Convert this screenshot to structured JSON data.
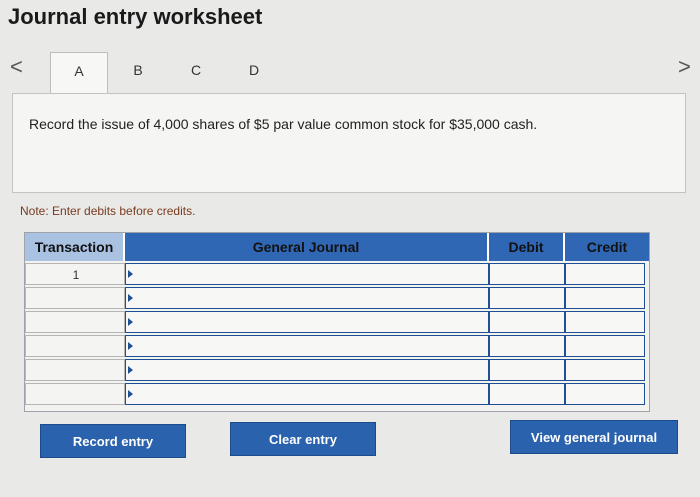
{
  "header": {
    "title": "Journal entry worksheet"
  },
  "nav": {
    "prev_icon": "chevron-left-icon",
    "next_icon": "chevron-right-icon",
    "prev_glyph": "<",
    "next_glyph": ">"
  },
  "tabs": [
    {
      "label": "A",
      "active": true
    },
    {
      "label": "B",
      "active": false
    },
    {
      "label": "C",
      "active": false
    },
    {
      "label": "D",
      "active": false
    }
  ],
  "instruction": "Record the issue of 4,000 shares of $5 par value common stock for $35,000 cash.",
  "note": "Note: Enter debits before credits.",
  "journal": {
    "columns": [
      "Transaction",
      "General Journal",
      "Debit",
      "Credit"
    ],
    "rows": [
      {
        "transaction": "1",
        "account": "",
        "debit": "",
        "credit": ""
      },
      {
        "transaction": "",
        "account": "",
        "debit": "",
        "credit": ""
      },
      {
        "transaction": "",
        "account": "",
        "debit": "",
        "credit": ""
      },
      {
        "transaction": "",
        "account": "",
        "debit": "",
        "credit": ""
      },
      {
        "transaction": "",
        "account": "",
        "debit": "",
        "credit": ""
      },
      {
        "transaction": "",
        "account": "",
        "debit": "",
        "credit": ""
      }
    ]
  },
  "buttons": {
    "record": "Record entry",
    "clear": "Clear entry",
    "view": "View general journal"
  },
  "colors": {
    "accent": "#2a62ad",
    "header_blue": "#2f67b4",
    "header_light": "#a9c2e2",
    "note": "#7a3a1e"
  }
}
